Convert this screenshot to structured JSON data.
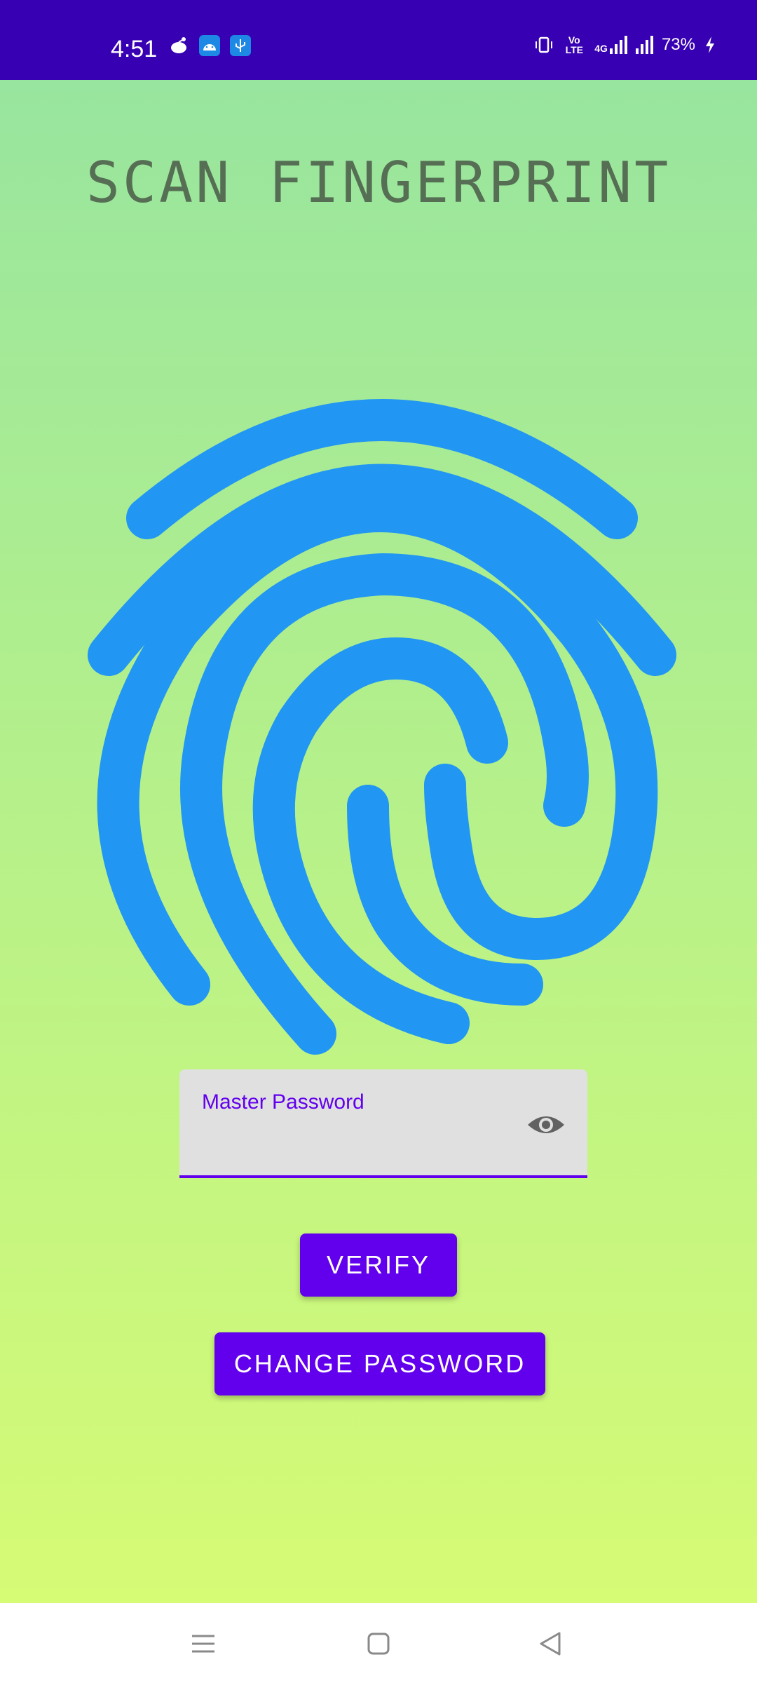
{
  "status_bar": {
    "time": "4:51",
    "network_label": "4G",
    "volte_label": "Vo LTE",
    "battery": "73%",
    "colors": {
      "background": "#3700b3"
    },
    "icons": [
      "reddit-icon",
      "android-icon",
      "usb-icon",
      "vibrate-icon",
      "volte-icon",
      "signal-4g-icon",
      "signal-icon",
      "battery-charging-icon"
    ]
  },
  "screen": {
    "title": "SCAN FINGERPRINT",
    "fingerprint_icon": "fingerprint-icon",
    "colors": {
      "gradient_top": "#98e59f",
      "gradient_bottom": "#d6fb75",
      "fingerprint": "#2196f3",
      "accent": "#6200ee"
    }
  },
  "password_field": {
    "label": "Master Password",
    "value": "",
    "toggle_icon": "eye-icon"
  },
  "buttons": {
    "verify": "VERIFY",
    "change_password": "CHANGE PASSWORD"
  },
  "nav_bar": {
    "icons": [
      "menu-icon",
      "home-icon",
      "back-icon"
    ]
  }
}
